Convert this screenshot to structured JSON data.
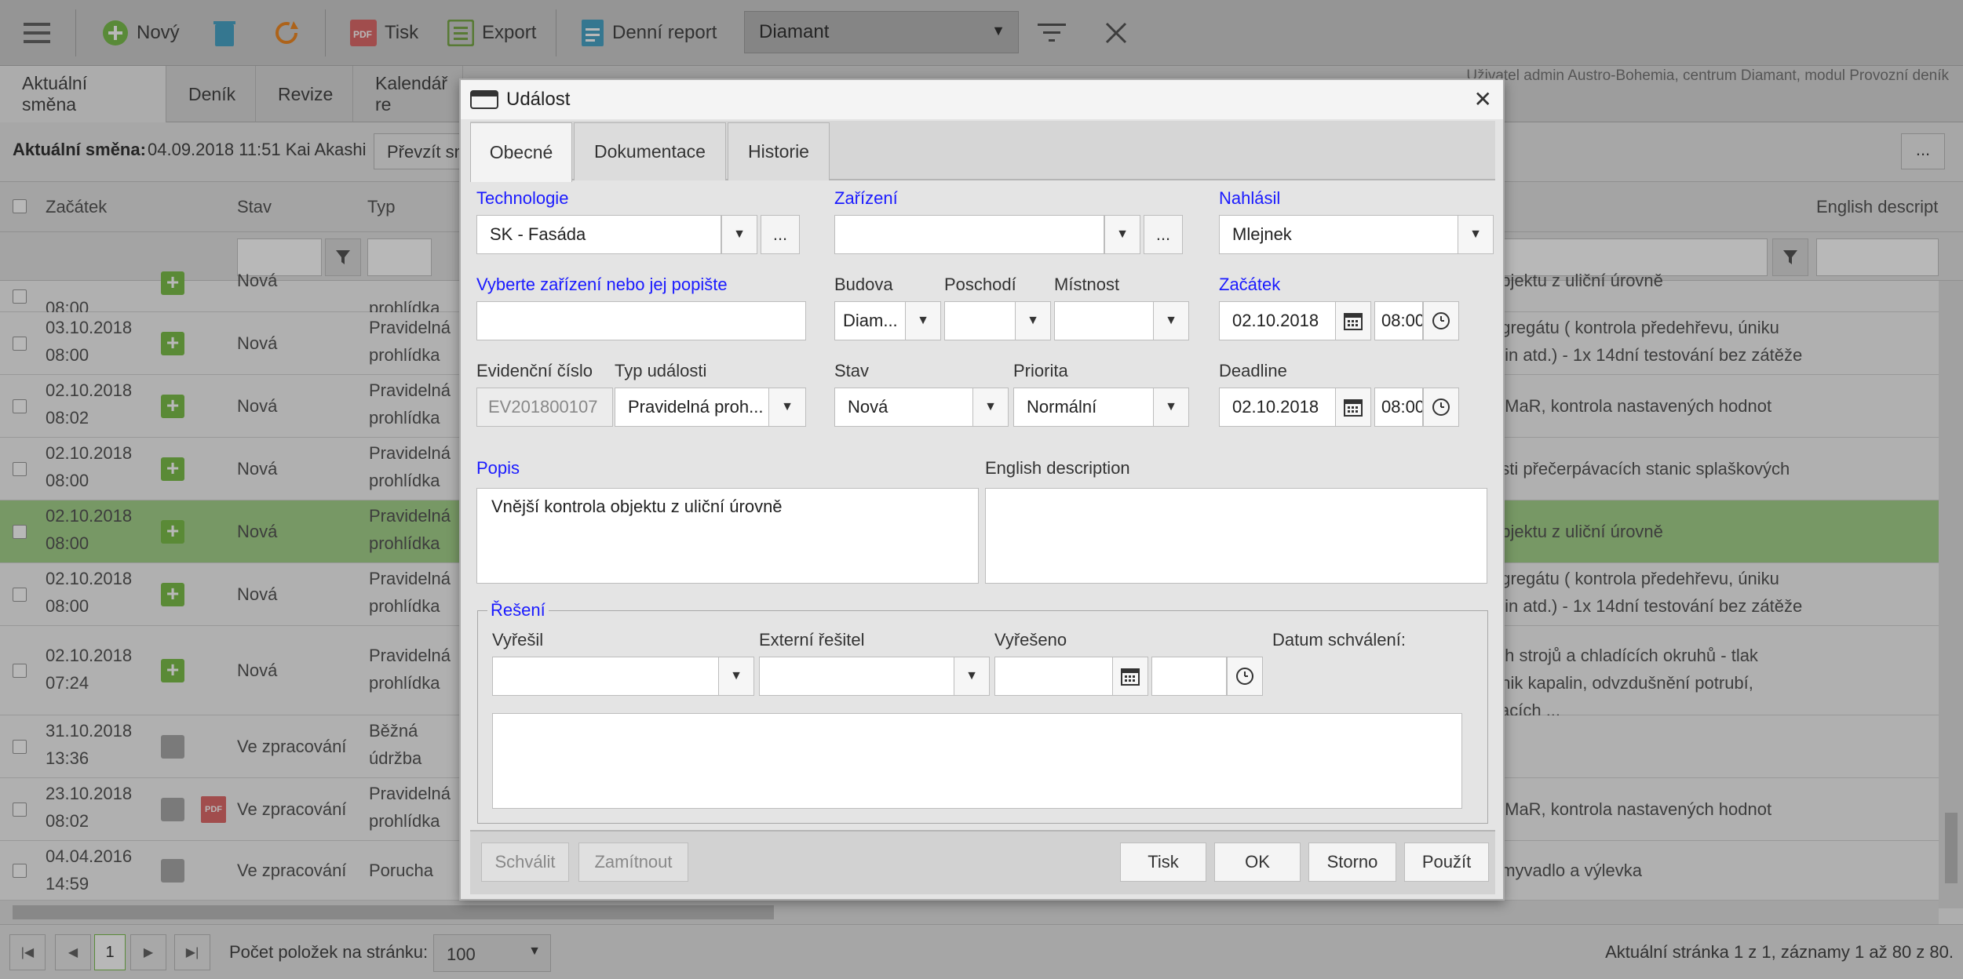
{
  "toolbar": {
    "new_label": "Nový",
    "print_label": "Tisk",
    "export_label": "Export",
    "report_label": "Denní report",
    "plant_value": "Diamant"
  },
  "main_tabs": [
    "Aktuální směna",
    "Deník",
    "Revize",
    "Kalendář re"
  ],
  "user_info": "Uživatel admin Austro-Bohemia, centrum Diamant, modul Provozní deník",
  "shift": {
    "label": "Aktuální směna:",
    "value": "04.09.2018 11:51 Kai Akashi",
    "take_over_button": "Převzít sm",
    "more_button": "..."
  },
  "grid": {
    "headers": {
      "start": "Začátek",
      "state": "Stav",
      "type": "Typ",
      "english": "English descript"
    },
    "rows": [
      {
        "date": "",
        "time": "08:00",
        "state": "Nová",
        "type1": "",
        "type2": "prohlídka",
        "desc1": "objektu z uliční úrovně",
        "desc2": "",
        "desc3": "",
        "icon": "plus",
        "selected": false
      },
      {
        "date": "03.10.2018",
        "time": "08:00",
        "state": "Nová",
        "type1": "Pravidelná",
        "type2": "prohlídka",
        "desc1": "agregátu ( kontrola předehřevu, úniku",
        "desc2": "alin atd.) - 1x 14dní testování bez zátěže",
        "desc3": "",
        "icon": "plus",
        "selected": false
      },
      {
        "date": "02.10.2018",
        "time": "08:02",
        "state": "Nová",
        "type1": "Pravidelná",
        "type2": "prohlídka",
        "desc1": "v MaR, kontrola nastavených hodnot",
        "desc2": "",
        "desc3": "",
        "icon": "plus",
        "selected": false
      },
      {
        "date": "02.10.2018",
        "time": "08:00",
        "state": "Nová",
        "type1": "Pravidelná",
        "type2": "prohlídka",
        "desc1": "osti přečerpávacích stanic splaškových",
        "desc2": "",
        "desc3": "",
        "icon": "plus",
        "selected": false
      },
      {
        "date": "02.10.2018",
        "time": "08:00",
        "state": "Nová",
        "type1": "Pravidelná",
        "type2": "prohlídka",
        "desc1": "objektu z uliční úrovně",
        "desc2": "",
        "desc3": "",
        "icon": "plus",
        "selected": true
      },
      {
        "date": "02.10.2018",
        "time": "08:00",
        "state": "Nová",
        "type1": "Pravidelná",
        "type2": "prohlídka",
        "desc1": "agregátu ( kontrola předehřevu, úniku",
        "desc2": "alin atd.) - 1x 14dní testování bez zátěže",
        "desc3": "",
        "icon": "plus",
        "selected": false
      },
      {
        "date": "02.10.2018",
        "time": "07:24",
        "state": "Nová",
        "type1": "Pravidelná",
        "type2": "prohlídka",
        "desc1": "ích strojů a chladících okruhů - tlak",
        "desc2": "únik kapalin, odvzdušnění potrubí,",
        "desc3": "vacích ...",
        "icon": "plus",
        "selected": false
      },
      {
        "date": "31.10.2018",
        "time": "13:36",
        "state": "Ve zpracování",
        "type1": "Běžná",
        "type2": "údržba",
        "desc1": "",
        "desc2": "",
        "desc3": "",
        "icon": "gear",
        "selected": false
      },
      {
        "date": "23.10.2018",
        "time": "08:02",
        "state": "Ve zpracování",
        "type1": "Pravidelná",
        "type2": "prohlídka",
        "desc1": "v MaR, kontrola nastavených hodnot",
        "desc2": "",
        "desc3": "",
        "icon": "gear",
        "selected": false
      },
      {
        "date": "04.04.2016",
        "time": "14:59",
        "state": "Ve zpracování",
        "type1": "Porucha",
        "type2": "",
        "desc1": "umyvadlo a výlevka",
        "desc2": "",
        "desc3": "",
        "icon": "gear",
        "selected": false
      }
    ]
  },
  "pager": {
    "page": "1",
    "page_size_label": "Počet položek na stránku:",
    "page_size": "100",
    "summary": "Aktuální stránka 1 z 1, záznamy 1 až 80 z 80."
  },
  "dialog": {
    "title": "Událost",
    "tabs": [
      "Obecné",
      "Dokumentace",
      "Historie"
    ],
    "technologie_label": "Technologie",
    "technologie_value": "SK - Fasáda",
    "zarizeni_label": "Zařízení",
    "zarizeni_value": "",
    "nahlasil_label": "Nahlásil",
    "nahlasil_value": "Mlejnek",
    "vyberte_label": "Vyberte zařízení nebo jej popište",
    "vyberte_value": "",
    "budova_label": "Budova",
    "budova_value": "Diam...",
    "poschodi_label": "Poschodí",
    "mistnost_label": "Místnost",
    "zacatek_label": "Začátek",
    "zacatek_date": "02.10.2018",
    "zacatek_time": "08:00",
    "evid_label": "Evidenční číslo",
    "evid_value": "EV201800107",
    "typ_label": "Typ události",
    "typ_value": "Pravidelná proh...",
    "stav_label": "Stav",
    "stav_value": "Nová",
    "priorita_label": "Priorita",
    "priorita_value": "Normální",
    "deadline_label": "Deadline",
    "deadline_date": "02.10.2018",
    "deadline_time": "08:00",
    "popis_label": "Popis",
    "popis_value": "Vnější kontrola objektu z uliční úrovně",
    "english_label": "English description",
    "english_value": "",
    "reseni_legend": "Řešení",
    "vyresil_label": "Vyřešil",
    "externi_label": "Externí řešitel",
    "vyreseno_label": "Vyřešeno",
    "schvaleni_label": "Datum schválení:",
    "ellipsis": "...",
    "buttons": {
      "schvalit": "Schválit",
      "zamitnout": "Zamítnout",
      "tisk": "Tisk",
      "ok": "OK",
      "storno": "Storno",
      "pouzit": "Použít"
    }
  }
}
